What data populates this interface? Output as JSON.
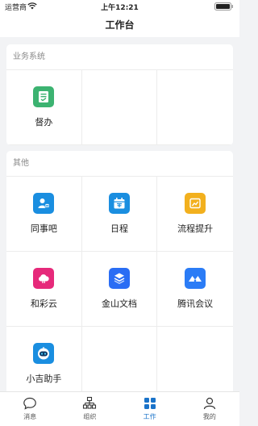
{
  "status_bar": {
    "carrier": "运营商",
    "time": "上午12:21"
  },
  "nav": {
    "title": "工作台"
  },
  "sections": [
    {
      "title": "业务系统",
      "apps": [
        {
          "label": "督办",
          "icon": "supervise-icon",
          "color": "#3cb371"
        }
      ]
    },
    {
      "title": "其他",
      "apps": [
        {
          "label": "同事吧",
          "icon": "colleague-icon",
          "color": "#1a8ee0"
        },
        {
          "label": "日程",
          "icon": "calendar-icon",
          "color": "#1a8ee0"
        },
        {
          "label": "流程提升",
          "icon": "process-icon",
          "color": "#f2b01e"
        },
        {
          "label": "和彩云",
          "icon": "cloud-icon",
          "color": "#e6297a"
        },
        {
          "label": "金山文档",
          "icon": "kdocs-icon",
          "color": "#2a6df4"
        },
        {
          "label": "腾讯会议",
          "icon": "meeting-icon",
          "color": "#2b7cf6"
        },
        {
          "label": "小吉助手",
          "icon": "assistant-icon",
          "color": "#1a8ee0"
        }
      ]
    }
  ],
  "tabs": [
    {
      "label": "消息",
      "icon": "message-icon",
      "active": false
    },
    {
      "label": "组织",
      "icon": "organization-icon",
      "active": false
    },
    {
      "label": "工作",
      "icon": "work-icon",
      "active": true
    },
    {
      "label": "我的",
      "icon": "profile-icon",
      "active": false
    }
  ],
  "colors": {
    "accent": "#1a73c9",
    "background": "#f2f3f5"
  }
}
